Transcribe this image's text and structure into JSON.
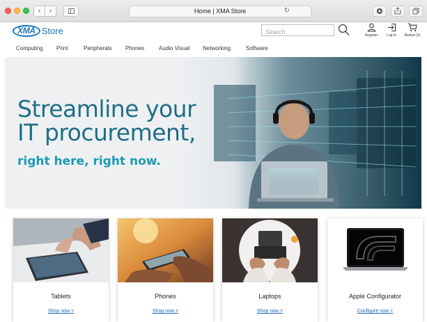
{
  "browser": {
    "tab_title": "Home | XMA Store",
    "nav_back": "‹",
    "nav_forward": "›",
    "reload": "↻"
  },
  "header": {
    "logo_mark": "XMA",
    "logo_text": "Store",
    "search_placeholder": "Search",
    "actions": [
      {
        "label": "Register",
        "icon": "user-icon"
      },
      {
        "label": "Log In",
        "icon": "login-icon"
      },
      {
        "label": "Basket (0)",
        "icon": "basket-icon"
      }
    ]
  },
  "nav": {
    "items": [
      "Computing",
      "Print",
      "Peripherals",
      "Phones",
      "Audio Visual",
      "Networking",
      "Software"
    ]
  },
  "hero": {
    "headline_line1": "Streamline your",
    "headline_line2": "IT procurement,",
    "subheadline": "right here, right now."
  },
  "categories": [
    {
      "name": "Tablets",
      "link": "Shop now >"
    },
    {
      "name": "Phones",
      "link": "Shop now >"
    },
    {
      "name": "Laptops",
      "link": "Shop now >"
    },
    {
      "name": "Apple Configurator",
      "link": "Configure now >"
    }
  ],
  "colors": {
    "brand_blue": "#1b75bc",
    "hero_headline": "#1f6f86",
    "hero_accent": "#1c9bb1",
    "link_blue": "#1b66b3"
  }
}
